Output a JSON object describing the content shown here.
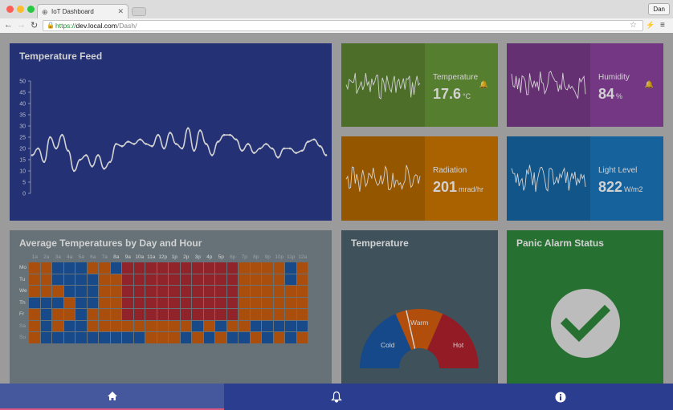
{
  "browser": {
    "tab_title": "IoT Dashboard",
    "user": "Dan",
    "url_scheme": "https://",
    "url_host": "dev.local.com",
    "url_path": "/Dash/"
  },
  "feed": {
    "title": "Temperature Feed",
    "color": "#2c3e8f"
  },
  "tiles": {
    "temperature": {
      "label": "Temperature",
      "value": "17.6",
      "unit": "°C",
      "color": "#6a9a3a"
    },
    "humidity": {
      "label": "Humidity",
      "value": "84",
      "unit": "%",
      "color": "#8e44a0"
    },
    "radiation": {
      "label": "Radiation",
      "value": "201",
      "unit": "mrad/hr",
      "color": "#d07800"
    },
    "light": {
      "label": "Light Level",
      "value": "822",
      "unit": "W/m2",
      "color": "#1a78c0"
    }
  },
  "heatmap": {
    "title": "Average Temperatures by Day and Hour",
    "hours": [
      "1a",
      "2a",
      "3a",
      "4a",
      "5a",
      "6a",
      "7a",
      "8a",
      "9a",
      "10a",
      "11a",
      "12p",
      "1p",
      "2p",
      "3p",
      "4p",
      "5p",
      "6p",
      "7p",
      "8p",
      "9p",
      "10p",
      "11p",
      "12a"
    ],
    "days": [
      "Mo",
      "Tu",
      "We",
      "Th",
      "Fr",
      "Sa",
      "Su"
    ],
    "colors": {
      "cold": "#1e5aa8",
      "warm": "#d06010",
      "hot": "#b02d34"
    },
    "grid": [
      "WWCCCWWCHHHHHHHHHHWWWWCW",
      "WWCCCCWWHHHHHHHHHHWWWWCW",
      "WWWCCCWWHHHHHHHHHHWWWWWW",
      "CCCWCCWWHHHHHHHHHHWWWWWW",
      "WCWWCWWWHHHHHHHHHHWWWWWW",
      "WCWCCWWWWWWWWWCWCWWCCCCC",
      "WCCCCCCCCCWWWCWCWCCWCWCW"
    ]
  },
  "gauge": {
    "title": "Temperature",
    "labels": {
      "cold": "Cold",
      "warm": "Warm",
      "hot": "Hot"
    },
    "colors": {
      "cold": "#1a5aa8",
      "warm": "#d9600f",
      "hot": "#b2222f"
    }
  },
  "alarm": {
    "title": "Panic Alarm Status",
    "color": "#2f8a3c"
  },
  "bottom_nav": [
    {
      "icon": "home-icon",
      "color": "#46589d"
    },
    {
      "icon": "bell-icon",
      "color": "#2b3d8f"
    },
    {
      "icon": "info-icon",
      "color": "#2b3d8f"
    }
  ],
  "chart_data": {
    "type": "line",
    "title": "Temperature Feed",
    "ylim": [
      0,
      50
    ],
    "yticks": [
      0,
      5,
      10,
      15,
      20,
      25,
      30,
      35,
      40,
      45,
      50
    ],
    "values": [
      17,
      20,
      14,
      25,
      20,
      26,
      19,
      10,
      15,
      17,
      12,
      17,
      11,
      14,
      22,
      21,
      23,
      22,
      24,
      22,
      21,
      26,
      20,
      27,
      22,
      20,
      29,
      19,
      28,
      22,
      17,
      23,
      26,
      26,
      24,
      19,
      22,
      18,
      20,
      22,
      20,
      16,
      20,
      20,
      18,
      19,
      23,
      24,
      21,
      17
    ]
  }
}
